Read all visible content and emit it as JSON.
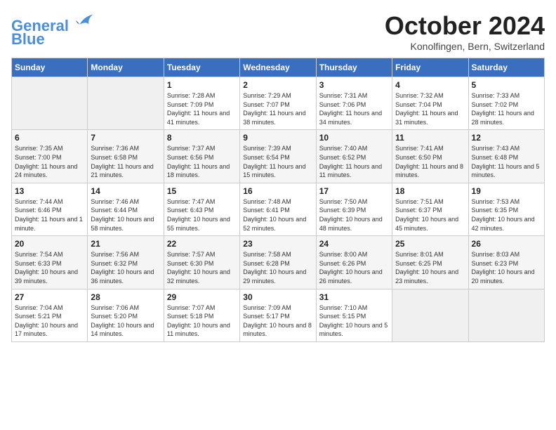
{
  "header": {
    "logo_line1": "General",
    "logo_line2": "Blue",
    "month": "October 2024",
    "location": "Konolfingen, Bern, Switzerland"
  },
  "weekdays": [
    "Sunday",
    "Monday",
    "Tuesday",
    "Wednesday",
    "Thursday",
    "Friday",
    "Saturday"
  ],
  "weeks": [
    [
      {
        "day": "",
        "sunrise": "",
        "sunset": "",
        "daylight": ""
      },
      {
        "day": "",
        "sunrise": "",
        "sunset": "",
        "daylight": ""
      },
      {
        "day": "1",
        "sunrise": "Sunrise: 7:28 AM",
        "sunset": "Sunset: 7:09 PM",
        "daylight": "Daylight: 11 hours and 41 minutes."
      },
      {
        "day": "2",
        "sunrise": "Sunrise: 7:29 AM",
        "sunset": "Sunset: 7:07 PM",
        "daylight": "Daylight: 11 hours and 38 minutes."
      },
      {
        "day": "3",
        "sunrise": "Sunrise: 7:31 AM",
        "sunset": "Sunset: 7:06 PM",
        "daylight": "Daylight: 11 hours and 34 minutes."
      },
      {
        "day": "4",
        "sunrise": "Sunrise: 7:32 AM",
        "sunset": "Sunset: 7:04 PM",
        "daylight": "Daylight: 11 hours and 31 minutes."
      },
      {
        "day": "5",
        "sunrise": "Sunrise: 7:33 AM",
        "sunset": "Sunset: 7:02 PM",
        "daylight": "Daylight: 11 hours and 28 minutes."
      }
    ],
    [
      {
        "day": "6",
        "sunrise": "Sunrise: 7:35 AM",
        "sunset": "Sunset: 7:00 PM",
        "daylight": "Daylight: 11 hours and 24 minutes."
      },
      {
        "day": "7",
        "sunrise": "Sunrise: 7:36 AM",
        "sunset": "Sunset: 6:58 PM",
        "daylight": "Daylight: 11 hours and 21 minutes."
      },
      {
        "day": "8",
        "sunrise": "Sunrise: 7:37 AM",
        "sunset": "Sunset: 6:56 PM",
        "daylight": "Daylight: 11 hours and 18 minutes."
      },
      {
        "day": "9",
        "sunrise": "Sunrise: 7:39 AM",
        "sunset": "Sunset: 6:54 PM",
        "daylight": "Daylight: 11 hours and 15 minutes."
      },
      {
        "day": "10",
        "sunrise": "Sunrise: 7:40 AM",
        "sunset": "Sunset: 6:52 PM",
        "daylight": "Daylight: 11 hours and 11 minutes."
      },
      {
        "day": "11",
        "sunrise": "Sunrise: 7:41 AM",
        "sunset": "Sunset: 6:50 PM",
        "daylight": "Daylight: 11 hours and 8 minutes."
      },
      {
        "day": "12",
        "sunrise": "Sunrise: 7:43 AM",
        "sunset": "Sunset: 6:48 PM",
        "daylight": "Daylight: 11 hours and 5 minutes."
      }
    ],
    [
      {
        "day": "13",
        "sunrise": "Sunrise: 7:44 AM",
        "sunset": "Sunset: 6:46 PM",
        "daylight": "Daylight: 11 hours and 1 minute."
      },
      {
        "day": "14",
        "sunrise": "Sunrise: 7:46 AM",
        "sunset": "Sunset: 6:44 PM",
        "daylight": "Daylight: 10 hours and 58 minutes."
      },
      {
        "day": "15",
        "sunrise": "Sunrise: 7:47 AM",
        "sunset": "Sunset: 6:43 PM",
        "daylight": "Daylight: 10 hours and 55 minutes."
      },
      {
        "day": "16",
        "sunrise": "Sunrise: 7:48 AM",
        "sunset": "Sunset: 6:41 PM",
        "daylight": "Daylight: 10 hours and 52 minutes."
      },
      {
        "day": "17",
        "sunrise": "Sunrise: 7:50 AM",
        "sunset": "Sunset: 6:39 PM",
        "daylight": "Daylight: 10 hours and 48 minutes."
      },
      {
        "day": "18",
        "sunrise": "Sunrise: 7:51 AM",
        "sunset": "Sunset: 6:37 PM",
        "daylight": "Daylight: 10 hours and 45 minutes."
      },
      {
        "day": "19",
        "sunrise": "Sunrise: 7:53 AM",
        "sunset": "Sunset: 6:35 PM",
        "daylight": "Daylight: 10 hours and 42 minutes."
      }
    ],
    [
      {
        "day": "20",
        "sunrise": "Sunrise: 7:54 AM",
        "sunset": "Sunset: 6:33 PM",
        "daylight": "Daylight: 10 hours and 39 minutes."
      },
      {
        "day": "21",
        "sunrise": "Sunrise: 7:56 AM",
        "sunset": "Sunset: 6:32 PM",
        "daylight": "Daylight: 10 hours and 36 minutes."
      },
      {
        "day": "22",
        "sunrise": "Sunrise: 7:57 AM",
        "sunset": "Sunset: 6:30 PM",
        "daylight": "Daylight: 10 hours and 32 minutes."
      },
      {
        "day": "23",
        "sunrise": "Sunrise: 7:58 AM",
        "sunset": "Sunset: 6:28 PM",
        "daylight": "Daylight: 10 hours and 29 minutes."
      },
      {
        "day": "24",
        "sunrise": "Sunrise: 8:00 AM",
        "sunset": "Sunset: 6:26 PM",
        "daylight": "Daylight: 10 hours and 26 minutes."
      },
      {
        "day": "25",
        "sunrise": "Sunrise: 8:01 AM",
        "sunset": "Sunset: 6:25 PM",
        "daylight": "Daylight: 10 hours and 23 minutes."
      },
      {
        "day": "26",
        "sunrise": "Sunrise: 8:03 AM",
        "sunset": "Sunset: 6:23 PM",
        "daylight": "Daylight: 10 hours and 20 minutes."
      }
    ],
    [
      {
        "day": "27",
        "sunrise": "Sunrise: 7:04 AM",
        "sunset": "Sunset: 5:21 PM",
        "daylight": "Daylight: 10 hours and 17 minutes."
      },
      {
        "day": "28",
        "sunrise": "Sunrise: 7:06 AM",
        "sunset": "Sunset: 5:20 PM",
        "daylight": "Daylight: 10 hours and 14 minutes."
      },
      {
        "day": "29",
        "sunrise": "Sunrise: 7:07 AM",
        "sunset": "Sunset: 5:18 PM",
        "daylight": "Daylight: 10 hours and 11 minutes."
      },
      {
        "day": "30",
        "sunrise": "Sunrise: 7:09 AM",
        "sunset": "Sunset: 5:17 PM",
        "daylight": "Daylight: 10 hours and 8 minutes."
      },
      {
        "day": "31",
        "sunrise": "Sunrise: 7:10 AM",
        "sunset": "Sunset: 5:15 PM",
        "daylight": "Daylight: 10 hours and 5 minutes."
      },
      {
        "day": "",
        "sunrise": "",
        "sunset": "",
        "daylight": ""
      },
      {
        "day": "",
        "sunrise": "",
        "sunset": "",
        "daylight": ""
      }
    ]
  ]
}
